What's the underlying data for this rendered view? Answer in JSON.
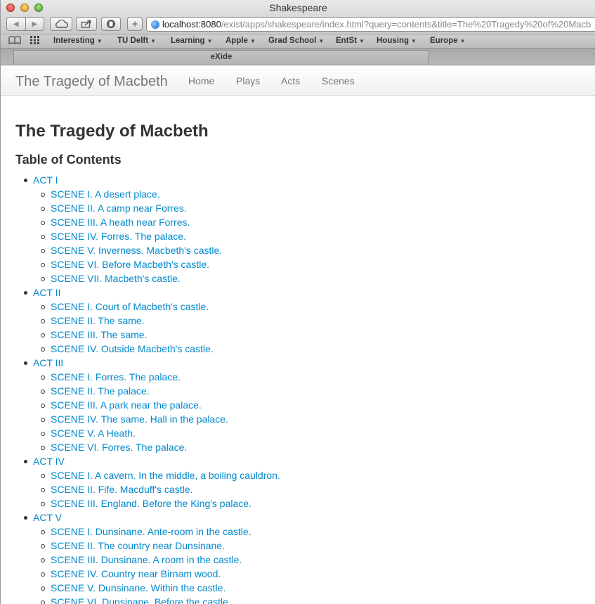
{
  "window": {
    "title": "Shakespeare"
  },
  "toolbar": {
    "url_host": "localhost:8080",
    "url_path": "/exist/apps/shakespeare/index.html?query=contents&title=The%20Tragedy%20of%20Macb"
  },
  "bookmarks": [
    "Interesting",
    "TU Delft",
    "Learning",
    "Apple",
    "Grad School",
    "EntSt",
    "Housing",
    "Europe"
  ],
  "tab": {
    "label": "eXide"
  },
  "navbar": {
    "brand": "The Tragedy of Macbeth",
    "links": [
      "Home",
      "Plays",
      "Acts",
      "Scenes"
    ]
  },
  "page": {
    "title": "The Tragedy of Macbeth",
    "toc_heading": "Table of Contents"
  },
  "acts": [
    {
      "label": "ACT I",
      "scenes": [
        "SCENE I. A desert place.",
        "SCENE II. A camp near Forres.",
        "SCENE III. A heath near Forres.",
        "SCENE IV. Forres. The palace.",
        "SCENE V. Inverness. Macbeth's castle.",
        "SCENE VI. Before Macbeth's castle.",
        "SCENE VII. Macbeth's castle."
      ]
    },
    {
      "label": "ACT II",
      "scenes": [
        "SCENE I. Court of Macbeth's castle.",
        "SCENE II. The same.",
        "SCENE III. The same.",
        "SCENE IV. Outside Macbeth's castle."
      ]
    },
    {
      "label": "ACT III",
      "scenes": [
        "SCENE I. Forres. The palace.",
        "SCENE II. The palace.",
        "SCENE III. A park near the palace.",
        "SCENE IV. The same. Hall in the palace.",
        "SCENE V. A Heath.",
        "SCENE VI. Forres. The palace."
      ]
    },
    {
      "label": "ACT IV",
      "scenes": [
        "SCENE I. A cavern. In the middle, a boiling cauldron.",
        "SCENE II. Fife. Macduff's castle.",
        "SCENE III. England. Before the King's palace."
      ]
    },
    {
      "label": "ACT V",
      "scenes": [
        "SCENE I. Dunsinane. Ante-room in the castle.",
        "SCENE II. The country near Dunsinane.",
        "SCENE III. Dunsinane. A room in the castle.",
        "SCENE IV. Country near Birnam wood.",
        "SCENE V. Dunsinane. Within the castle.",
        "SCENE VI. Dunsinane. Before the castle."
      ]
    }
  ]
}
